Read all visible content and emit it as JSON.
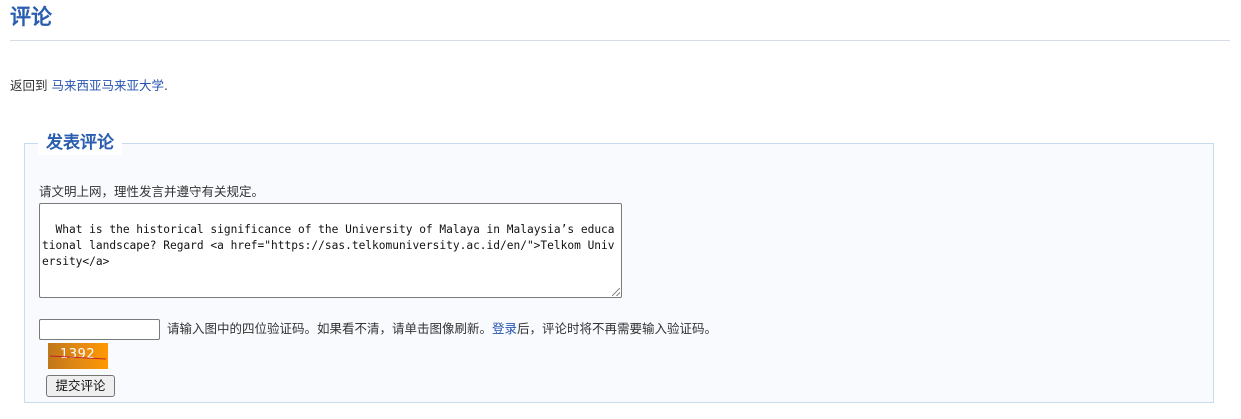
{
  "header": {
    "title": "评论"
  },
  "back": {
    "prefix": "返回到",
    "link_text": "马来西亚马来亚大学",
    "suffix": "."
  },
  "form": {
    "legend": "发表评论",
    "notice": "请文明上网，理性发言并遵守有关规定。",
    "comment_value": "What is the historical significance of the University of Malaya in Malaysia’s educational landscape? Regard <a href=\"https://sas.telkomuniversity.ac.id/en/\">Telkom University</a>",
    "captcha": {
      "input_value": "",
      "hint_before": "请输入图中的四位验证码。如果看不清，请单击图像刷新。",
      "login_link": "登录",
      "hint_after": "后，评论时将不再需要输入验证码。",
      "image_text": "1392"
    },
    "submit_label": "提交评论"
  },
  "colors": {
    "accent": "#2a5db0",
    "link": "#2653b0",
    "fieldset_bg": "#f8fafe"
  }
}
